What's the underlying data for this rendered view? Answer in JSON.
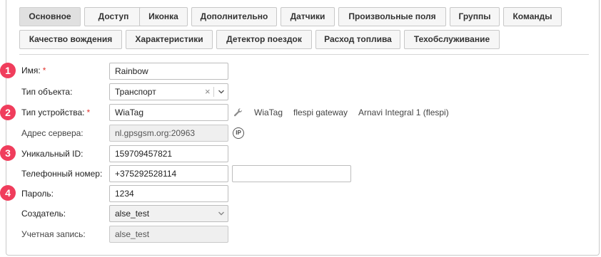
{
  "tabs": [
    {
      "label": "Основное",
      "active": true
    },
    {
      "label": "Доступ"
    },
    {
      "label": "Иконка"
    },
    {
      "label": "Дополнительно"
    },
    {
      "label": "Датчики"
    },
    {
      "label": "Произвольные поля"
    },
    {
      "label": "Группы"
    },
    {
      "label": "Команды"
    },
    {
      "label": "Качество вождения"
    },
    {
      "label": "Характеристики"
    },
    {
      "label": "Детектор поездок"
    },
    {
      "label": "Расход топлива"
    },
    {
      "label": "Техобслуживание"
    }
  ],
  "badges": [
    "1",
    "2",
    "3",
    "4"
  ],
  "form": {
    "name": {
      "label": "Имя:",
      "required": "*",
      "value": "Rainbow"
    },
    "object_type": {
      "label": "Тип объекта:",
      "value": "Транспорт",
      "clear": "×"
    },
    "device_type": {
      "label": "Тип устройства:",
      "required": "*",
      "value": "WiaTag",
      "options": [
        "WiaTag",
        "flespi gateway",
        "Arnavi Integral 1 (flespi)"
      ]
    },
    "server_address": {
      "label": "Адрес сервера:",
      "value": "nl.gpsgsm.org:20963",
      "ip_icon": "IP"
    },
    "unique_id": {
      "label": "Уникальный ID:",
      "value": "159709457821"
    },
    "phone": {
      "label": "Телефонный номер:",
      "value": "+375292528114",
      "value2": ""
    },
    "password": {
      "label": "Пароль:",
      "value": "1234"
    },
    "creator": {
      "label": "Создатель:",
      "value": "alse_test"
    },
    "account": {
      "label": "Учетная запись:",
      "value": "alse_test"
    }
  },
  "colors": {
    "badge": "#f03d5c",
    "required": "#e3342f",
    "active_tab": "#e0e0e0"
  }
}
